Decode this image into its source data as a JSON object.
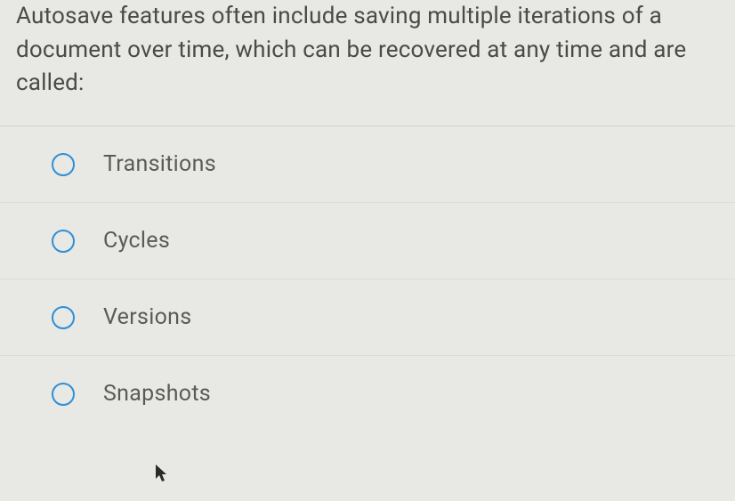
{
  "question": "Autosave features often include saving multiple iterations of a document over time, which can be recovered at any time and are called:",
  "options": [
    {
      "label": "Transitions"
    },
    {
      "label": "Cycles"
    },
    {
      "label": "Versions"
    },
    {
      "label": "Snapshots"
    }
  ]
}
